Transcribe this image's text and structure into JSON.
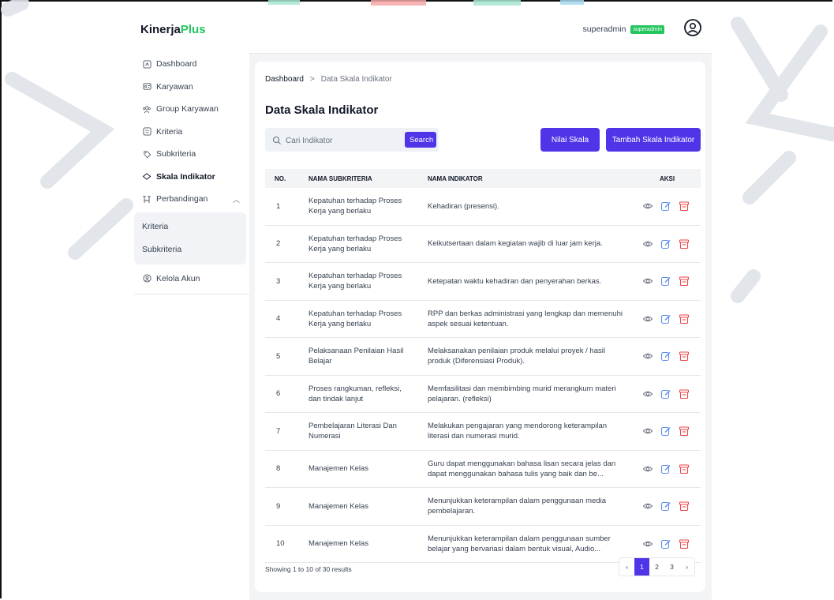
{
  "app": {
    "logo_main": "Kinerja",
    "logo_accent": "Plus"
  },
  "header": {
    "username": "superadmin",
    "role_badge": "superadmin"
  },
  "sidebar": {
    "items": [
      {
        "label": "Dashboard",
        "icon": "dashboard-icon"
      },
      {
        "label": "Karyawan",
        "icon": "id-card-icon"
      },
      {
        "label": "Group Karyawan",
        "icon": "group-icon"
      },
      {
        "label": "Kriteria",
        "icon": "list-icon"
      },
      {
        "label": "Subkriteria",
        "icon": "tag-icon"
      },
      {
        "label": "Skala Indikator",
        "icon": "scale-icon",
        "active": true
      },
      {
        "label": "Perbandingan",
        "icon": "compare-icon",
        "expanded": true
      }
    ],
    "submenu": [
      {
        "label": "Kriteria"
      },
      {
        "label": "Subkriteria"
      }
    ],
    "account": {
      "label": "Kelola Akun",
      "icon": "account-icon"
    }
  },
  "breadcrumb": {
    "home": "Dashboard",
    "separator": ">",
    "current": "Data Skala Indikator"
  },
  "page": {
    "title": "Data Skala Indikator"
  },
  "search": {
    "placeholder": "Cari Indikator",
    "value": "",
    "button": "Search"
  },
  "buttons": {
    "nilai": "Nilai Skala",
    "tambah": "Tambah Skala Indikator"
  },
  "table": {
    "columns": [
      "NO.",
      "NAMA SUBKRITERIA",
      "NAMA INDIKATOR",
      "AKSI"
    ],
    "rows": [
      {
        "no": "1",
        "sub": "Kepatuhan terhadap Proses Kerja yang berlaku",
        "ind": "Kehadiran (presensi)."
      },
      {
        "no": "2",
        "sub": "Kepatuhan terhadap Proses Kerja yang berlaku",
        "ind": "Keikutsertaan dalam kegiatan wajib di luar jam kerja."
      },
      {
        "no": "3",
        "sub": "Kepatuhan terhadap Proses Kerja yang berlaku",
        "ind": "Ketepatan waktu kehadiran dan penyerahan berkas."
      },
      {
        "no": "4",
        "sub": "Kepatuhan terhadap Proses Kerja yang berlaku",
        "ind": "RPP dan berkas administrasi yang lengkap dan memenuhi aspek sesuai ketentuan."
      },
      {
        "no": "5",
        "sub": "Pelaksanaan Penilaian Hasil Belajar",
        "ind": "Melaksanakan penilaian produk melalui proyek / hasil produk (Diferensiasi Produk)."
      },
      {
        "no": "6",
        "sub": "Proses rangkuman, refleksi, dan tindak lanjut",
        "ind": "Memfasilitasi dan membimbing murid merangkum materi pelajaran. (refleksi)"
      },
      {
        "no": "7",
        "sub": "Pembelajaran Literasi Dan Numerasi",
        "ind": "Melakukan pengajaran yang mendorong keterampilan literasi dan numerasi murid."
      },
      {
        "no": "8",
        "sub": "Manajemen Kelas",
        "ind": "Guru dapat menggunakan bahasa lisan secara jelas dan dapat menggunakan bahasa tulis yang baik dan be..."
      },
      {
        "no": "9",
        "sub": "Manajemen Kelas",
        "ind": "Menunjukkan keterampilan dalam penggunaan media pembelajaran."
      },
      {
        "no": "10",
        "sub": "Manajemen Kelas",
        "ind": "Menunjukkan keterampilan dalam penggunaan sumber belajar yang bervariasi dalam bentuk visual, Audio..."
      }
    ]
  },
  "pagination": {
    "summary": "Showing 1 to 10 of 30 results",
    "prev": "‹",
    "pages": [
      "1",
      "2",
      "3"
    ],
    "current": "1",
    "next": "›"
  },
  "colors": {
    "accent": "#4f35e8",
    "brand": "#22c55e"
  }
}
